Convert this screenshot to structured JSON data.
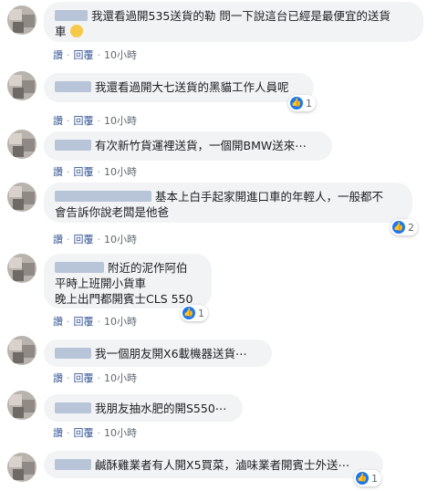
{
  "comments": [
    {
      "text_line1": "我還看過開535送貨的勒 問一下說這台已經是最便宜的送貨",
      "text_line2": "車",
      "emoji": "grinning-sweat-emoji"
    },
    {
      "text": "我還看過開大七送貨的黑貓工作人員呢",
      "reactions": "1"
    },
    {
      "text": "有次新竹貨運裡送貨，一個開BMW送來⋯"
    },
    {
      "text_line1": "基本上白手起家開進口車的年輕人，一般都不",
      "text_line2": "會告訴你說老闆是他爸",
      "reactions": "2"
    },
    {
      "text_line1": "附近的泥作阿伯",
      "text_line2": "平時上班開小貨車",
      "text_line3": "晚上出門都開賓士CLS 550",
      "reactions": "1"
    },
    {
      "text": "我一個朋友開X6載機器送貨⋯"
    },
    {
      "text": "我朋友抽水肥的開S550⋯"
    },
    {
      "text": "鹹酥雞業者有人開X5買菜，滷味業者開賓士外送⋯",
      "reactions": "1"
    }
  ],
  "actions": {
    "like": "讚",
    "reply": "回覆",
    "time": "10小時",
    "dot": "·"
  }
}
